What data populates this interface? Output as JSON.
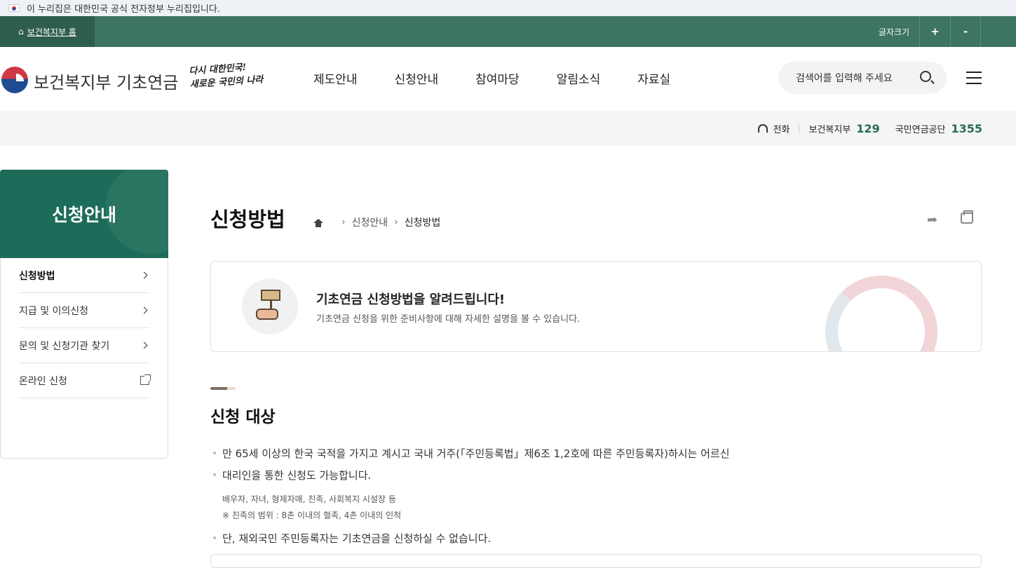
{
  "gov_banner": {
    "text": "이 누리집은 대한민국 공식 전자정부 누리집입니다."
  },
  "topbar": {
    "home_label": "보건복지부 홈",
    "font_size_label": "글자크기",
    "plus": "+",
    "minus": "-"
  },
  "header": {
    "logo_text": "보건복지부 기초연금",
    "slogan_line1": "다시 대한민국!",
    "slogan_line2": "새로운 국민의 나라",
    "nav": [
      "제도안내",
      "신청안내",
      "참여마당",
      "알림소식",
      "자료실"
    ],
    "search_placeholder": "검색어를 입력해 주세요"
  },
  "contact": {
    "phone_label": "전화",
    "org1": "보건복지부",
    "org1_num": "129",
    "org2": "국민연금공단",
    "org2_num": "1355"
  },
  "sidebar": {
    "title": "신청안내",
    "items": [
      {
        "label": "신청방법"
      },
      {
        "label": "지급 및 이의신청"
      },
      {
        "label": "문의 및 신청기관 찾기"
      },
      {
        "label": "온라인 신청"
      }
    ]
  },
  "main": {
    "title": "신청방법",
    "breadcrumb": [
      "신청안내",
      "신청방법"
    ],
    "intro_title": "기초연금 신청방법을 알려드립니다!",
    "intro_desc": "기초연금 신청을 위한 준비사항에 대해 자세한 설명을 볼 수 있습니다.",
    "section_title": "신청 대상",
    "bullet1": "만 65세 이상의 한국 국적을 가지고 계시고 국내 거주(「주민등록법」제6조 1,2호에 따른 주민등록자)하시는 어르신",
    "bullet2": "대리인을 통한 신청도 가능합니다.",
    "sub1": "배우자, 자녀, 형제자매, 친족, 사회복지 시설장 등",
    "sub2": "※ 친족의 범위 : 8촌 이내의 혈족, 4촌 이내의 인척",
    "bullet3": "단, 재외국민 주민등록자는 기초연금을 신청하실 수 없습니다."
  },
  "colors": {
    "brand": "#1d6c59",
    "topbar": "#3d7462",
    "accent_num": "#2a6b57"
  }
}
